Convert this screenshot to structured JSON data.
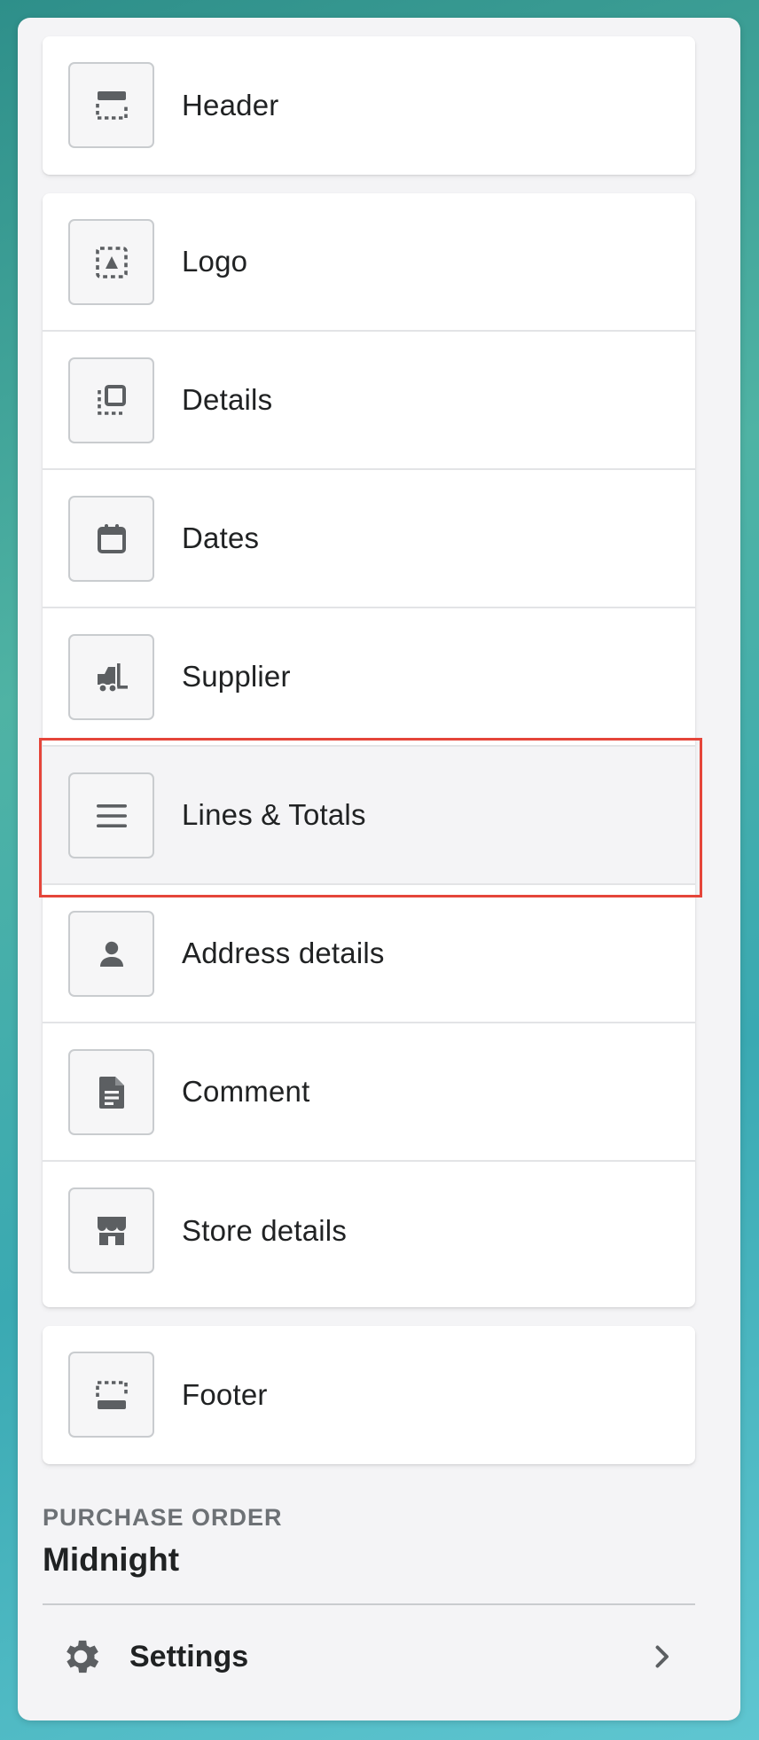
{
  "sections": {
    "header": {
      "label": "Header",
      "icon": "header-layout-icon"
    },
    "body_items": [
      {
        "id": "logo",
        "label": "Logo",
        "icon": "logo-placeholder-icon"
      },
      {
        "id": "details",
        "label": "Details",
        "icon": "details-layout-icon"
      },
      {
        "id": "dates",
        "label": "Dates",
        "icon": "calendar-icon"
      },
      {
        "id": "supplier",
        "label": "Supplier",
        "icon": "forklift-icon"
      },
      {
        "id": "lines-totals",
        "label": "Lines & Totals",
        "icon": "lines-menu-icon",
        "selected": true
      },
      {
        "id": "address-details",
        "label": "Address details",
        "icon": "person-icon"
      },
      {
        "id": "comment",
        "label": "Comment",
        "icon": "document-icon"
      },
      {
        "id": "store-details",
        "label": "Store details",
        "icon": "store-icon"
      }
    ],
    "footer": {
      "label": "Footer",
      "icon": "footer-layout-icon"
    }
  },
  "template": {
    "caption": "PURCHASE ORDER",
    "name": "Midnight"
  },
  "settings": {
    "label": "Settings",
    "icon": "gear-icon",
    "chevron": "chevron-right-icon"
  },
  "colors": {
    "highlight": "#e5453a",
    "icon": "#5c5f62",
    "text": "#202223",
    "muted": "#6d7175"
  }
}
